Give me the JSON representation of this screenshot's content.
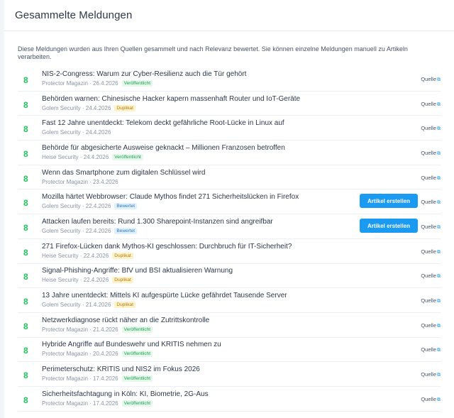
{
  "header": {
    "title": "Gesammelte Meldungen"
  },
  "intro": "Diese Meldungen wurden aus Ihren Quellen gesammelt und nach Relevanz bewertet. Sie können einzelne Meldungen manuell zu Artikeln verarbeiten.",
  "create_label": "Artikel erstellen",
  "source_label": "Quelle",
  "items": [
    {
      "score": "8",
      "title": "NIS-2-Congress: Warum zur Cyber-Resilienz auch die Tür gehört",
      "source": "Protector Magazin",
      "date": "26.4.2026",
      "status": "Veröffentlicht",
      "kind": "pub",
      "button": false
    },
    {
      "score": "8",
      "title": "Behörden warnen: Chinesische Hacker kapern massenhaft Router und IoT-Geräte",
      "source": "Golem Security",
      "date": "24.4.2026",
      "status": "Duplikat",
      "kind": "dup",
      "button": false
    },
    {
      "score": "8",
      "title": "Fast 12 Jahre unentdeckt: Telekom deckt gefährliche Root-Lücke in Linux auf",
      "source": "Golem Security",
      "date": "24.4.2026",
      "status": "",
      "kind": "",
      "button": false
    },
    {
      "score": "8",
      "title": "Behörde für abgesicherte Ausweise geknackt – Millionen Franzosen betroffen",
      "source": "Heise Security",
      "date": "24.4.2026",
      "status": "Veröffentlicht",
      "kind": "pub",
      "button": false
    },
    {
      "score": "8",
      "title": "Wenn das Smartphone zum digitalen Schlüssel wird",
      "source": "Protector Magazin",
      "date": "23.4.2026",
      "status": "",
      "kind": "",
      "button": false
    },
    {
      "score": "8",
      "title": "Mozilla härtet Webbrowser: Claude Mythos findet 271 Sicherheitslücken in Firefox",
      "source": "Golem Security",
      "date": "22.4.2026",
      "status": "Bewertet",
      "kind": "rated",
      "button": true
    },
    {
      "score": "8",
      "title": "Attacken laufen bereits: Rund 1.300 Sharepoint-Instanzen sind angreifbar",
      "source": "Golem Security",
      "date": "22.4.2026",
      "status": "Bewertet",
      "kind": "rated",
      "button": true
    },
    {
      "score": "8",
      "title": "271 Firefox-Lücken dank Mythos-KI geschlossen: Durchbruch für IT-Sicherheit?",
      "source": "Heise Security",
      "date": "22.4.2026",
      "status": "Duplikat",
      "kind": "dup",
      "button": false
    },
    {
      "score": "8",
      "title": "Signal-Phishing-Angriffe: BfV und BSI aktualisieren Warnung",
      "source": "Heise Security",
      "date": "22.4.2026",
      "status": "Duplikat",
      "kind": "dup",
      "button": false
    },
    {
      "score": "8",
      "title": "13 Jahre unentdeckt: Mittels KI aufgespürte Lücke gefährdet Tausende Server",
      "source": "Golem Security",
      "date": "21.4.2026",
      "status": "Duplikat",
      "kind": "dup",
      "button": false
    },
    {
      "score": "8",
      "title": "Netzwerkdiagnose rückt näher an die Zutrittskontrolle",
      "source": "Protector Magazin",
      "date": "21.4.2026",
      "status": "Veröffentlicht",
      "kind": "pub",
      "button": false
    },
    {
      "score": "8",
      "title": "Hybride Angriffe auf Bundeswehr und KRITIS nehmen zu",
      "source": "Protector Magazin",
      "date": "20.4.2026",
      "status": "Veröffentlicht",
      "kind": "pub",
      "button": false
    },
    {
      "score": "8",
      "title": "Perimeterschutz: KRITIS und NIS2 im Fokus 2026",
      "source": "Protector Magazin",
      "date": "17.4.2026",
      "status": "Veröffentlicht",
      "kind": "pub",
      "button": false
    },
    {
      "score": "8",
      "title": "Sicherheitsfachtagung in Köln: KI, Biometrie, 2G-Aus",
      "source": "Protector Magazin",
      "date": "17.4.2026",
      "status": "Veröffentlicht",
      "kind": "pub",
      "button": false
    }
  ]
}
